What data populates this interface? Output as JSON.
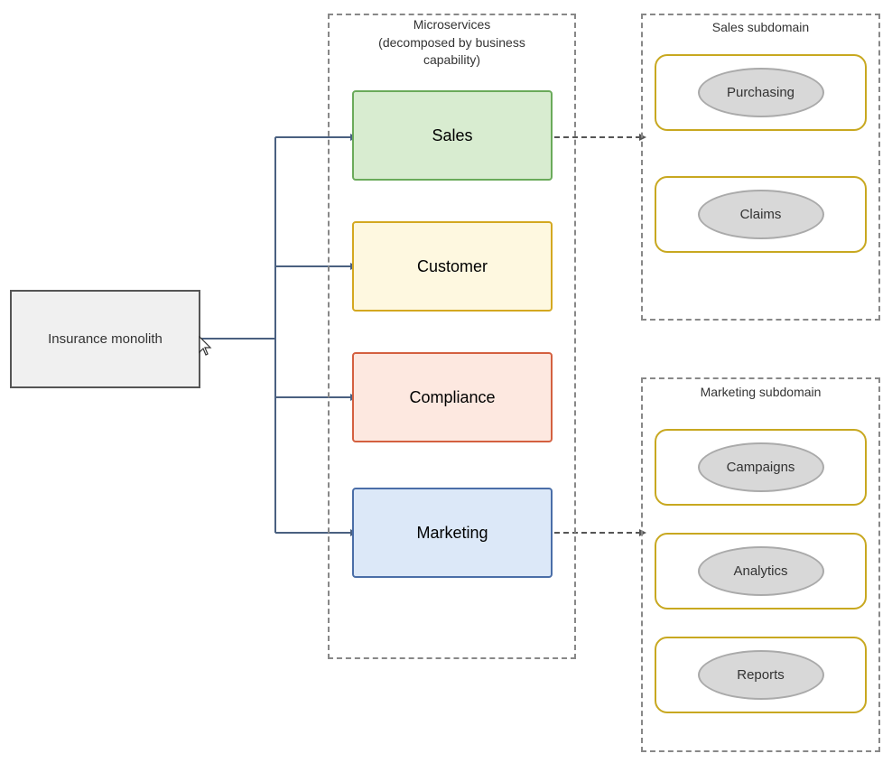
{
  "monolith": {
    "label": "Insurance monolith"
  },
  "microservices": {
    "title_line1": "Microservices",
    "title_line2": "(decomposed by business",
    "title_line3": "capability)",
    "services": [
      {
        "id": "sales",
        "label": "Sales"
      },
      {
        "id": "customer",
        "label": "Customer"
      },
      {
        "id": "compliance",
        "label": "Compliance"
      },
      {
        "id": "marketing",
        "label": "Marketing"
      }
    ]
  },
  "sales_subdomain": {
    "title": "Sales subdomain",
    "items": [
      {
        "id": "purchasing",
        "label": "Purchasing"
      },
      {
        "id": "claims",
        "label": "Claims"
      }
    ]
  },
  "marketing_subdomain": {
    "title": "Marketing subdomain",
    "items": [
      {
        "id": "campaigns",
        "label": "Campaigns"
      },
      {
        "id": "analytics",
        "label": "Analytics"
      },
      {
        "id": "reports",
        "label": "Reports"
      }
    ]
  }
}
